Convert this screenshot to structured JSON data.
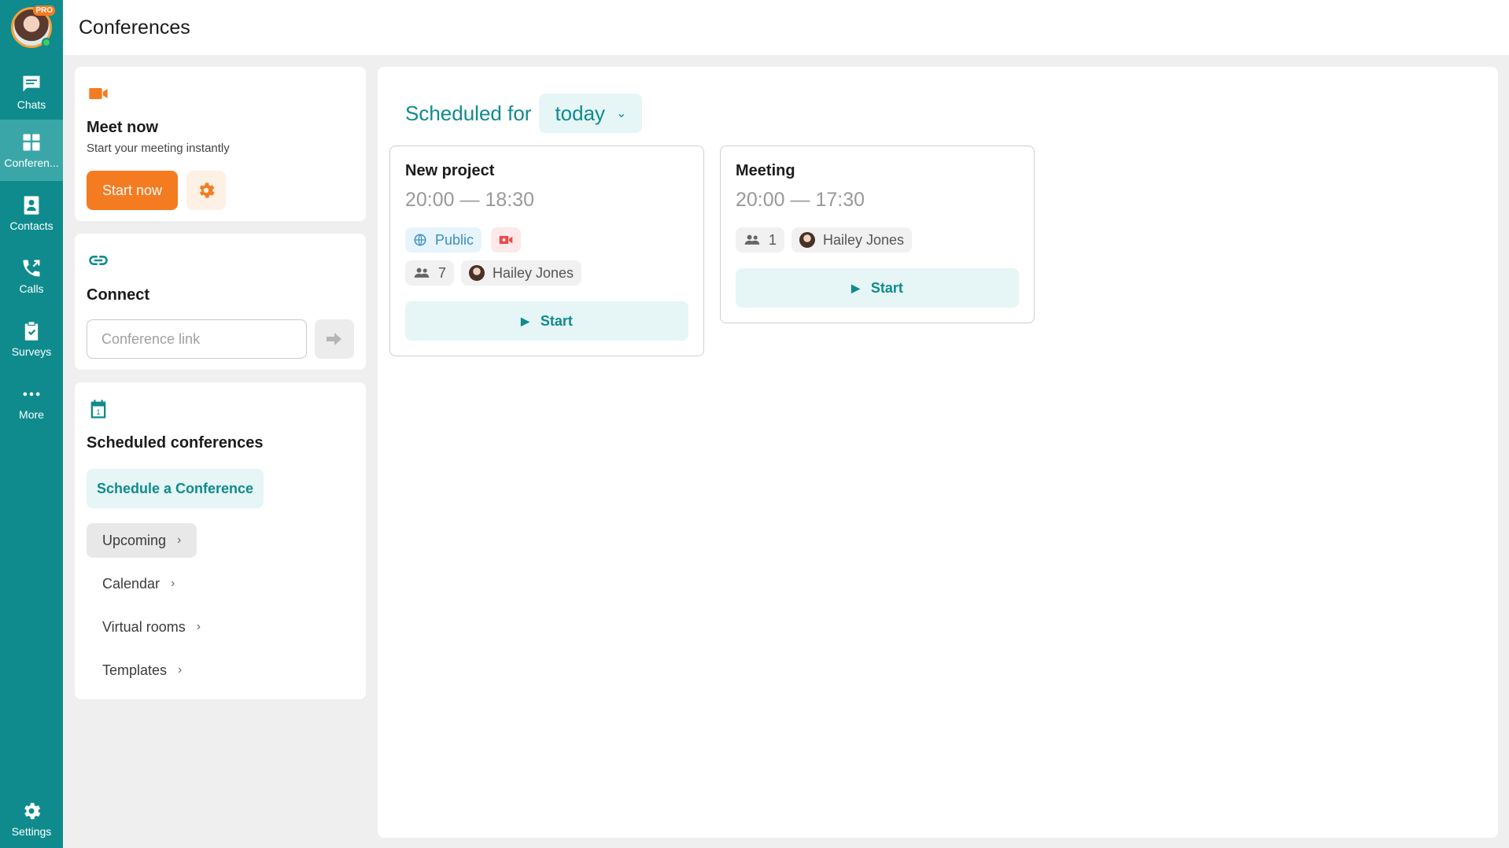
{
  "header": {
    "title": "Conferences"
  },
  "profile": {
    "badge": "PRO"
  },
  "nav": {
    "items": [
      {
        "label": "Chats"
      },
      {
        "label": "Conferen..."
      },
      {
        "label": "Contacts"
      },
      {
        "label": "Calls"
      },
      {
        "label": "Surveys"
      },
      {
        "label": "More"
      }
    ],
    "settings": "Settings"
  },
  "meet_now": {
    "title": "Meet now",
    "subtitle": "Start your meeting instantly",
    "start_label": "Start now"
  },
  "connect": {
    "title": "Connect",
    "placeholder": "Conference link"
  },
  "scheduled": {
    "title": "Scheduled conferences",
    "calendar_day": "1",
    "schedule_label": "Schedule a Conference",
    "links": [
      {
        "label": "Upcoming",
        "active": true
      },
      {
        "label": "Calendar"
      },
      {
        "label": "Virtual rooms"
      },
      {
        "label": "Templates"
      }
    ]
  },
  "main": {
    "scheduled_for_label": "Scheduled for",
    "period": "today",
    "conferences": [
      {
        "title": "New project",
        "time": "20:00 — 18:30",
        "visibility": "Public",
        "recording": true,
        "participants": "7",
        "owner": "Hailey Jones",
        "start_label": "Start"
      },
      {
        "title": "Meeting",
        "time": "20:00 — 17:30",
        "participants": "1",
        "owner": "Hailey Jones",
        "start_label": "Start"
      }
    ]
  },
  "colors": {
    "rail": "#0f8b8d",
    "rail_active": "#3aa6a8",
    "accent_orange": "#f47b20",
    "teal_text": "#0f8b8d",
    "teal_light_bg": "#e6f5f5"
  }
}
